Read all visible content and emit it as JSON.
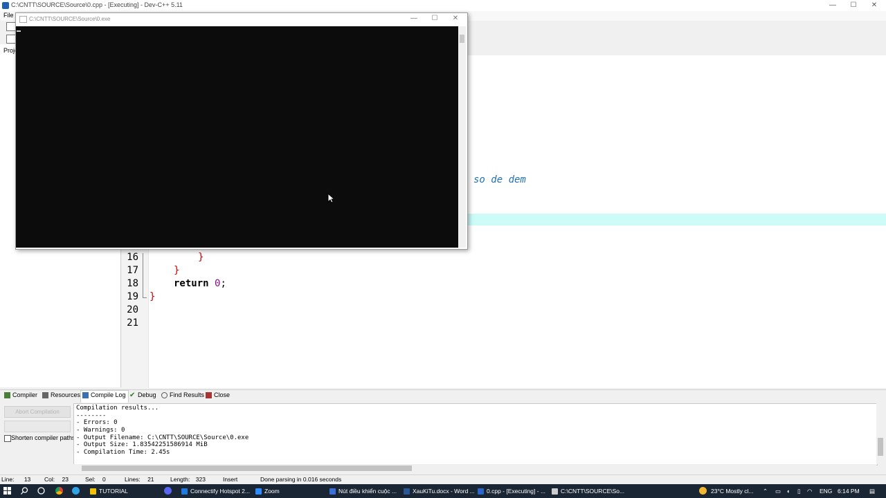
{
  "window": {
    "title": "C:\\CNTT\\SOURCE\\Source\\0.cpp - [Executing] - Dev-C++ 5.11",
    "min": "—",
    "max": "☐",
    "close": "✕"
  },
  "menu": {
    "file": "File"
  },
  "project_panel": {
    "label": "Proje"
  },
  "editor": {
    "comment_fragment": "so de dem",
    "lines": [
      {
        "n": "16",
        "text": "}"
      },
      {
        "n": "17",
        "text": "}"
      },
      {
        "n": "18",
        "kw": "return",
        "num": "0",
        "end": ";"
      },
      {
        "n": "19",
        "text": "}"
      },
      {
        "n": "20",
        "text": ""
      },
      {
        "n": "21",
        "text": ""
      }
    ]
  },
  "console": {
    "title": "C:\\CNTT\\SOURCE\\Source\\0.exe",
    "min": "—",
    "max": "☐",
    "close": "✕"
  },
  "bottom_tabs": [
    "Compiler",
    "Resources",
    "Compile Log",
    "Debug",
    "Find Results",
    "Close"
  ],
  "compile_panel": {
    "abort_label": "Abort Compilation",
    "shorten_label": "Shorten compiler paths",
    "log": [
      "Compilation results...",
      "--------",
      "- Errors: 0",
      "- Warnings: 0",
      "- Output Filename: C:\\CNTT\\SOURCE\\Source\\0.exe",
      "- Output Size: 1.83542251586914 MiB",
      "- Compilation Time: 2.45s"
    ]
  },
  "status": {
    "line_label": "Line:",
    "line": "13",
    "col_label": "Col:",
    "col": "23",
    "sel_label": "Sel:",
    "sel": "0",
    "lines_label": "Lines:",
    "lines": "21",
    "length_label": "Length:",
    "length": "323",
    "mode": "Insert",
    "message": "Done parsing in 0.016 seconds"
  },
  "taskbar": {
    "items": [
      {
        "label": "TUTORIAL",
        "color": "#f2c200"
      },
      {
        "label": "Connectify Hotspot 2...",
        "color": "#1f7ae0"
      },
      {
        "label": "Zoom",
        "color": "#2d8cff"
      },
      {
        "label": "Nút điều khiển cuộc ...",
        "color": "#3a6fd8"
      },
      {
        "label": "XauKiTu.docx - Word ...",
        "color": "#2b5797"
      },
      {
        "label": "0.cpp - [Executing] - ...",
        "color": "#2b65c7"
      },
      {
        "label": "C:\\CNTT\\SOURCE\\So...",
        "color": "#cccccc"
      }
    ],
    "weather": "23°C  Mostly cl...",
    "lang": "ENG",
    "time": "6:14 PM"
  },
  "colors": {
    "console_bg": "#0c0c0c",
    "highlight_line": "#ccfbf8",
    "keyword": "#000000",
    "number": "#8a0b8a",
    "brace": "#cc0000",
    "comment": "#2272b4",
    "taskbar": "#1b2635"
  }
}
